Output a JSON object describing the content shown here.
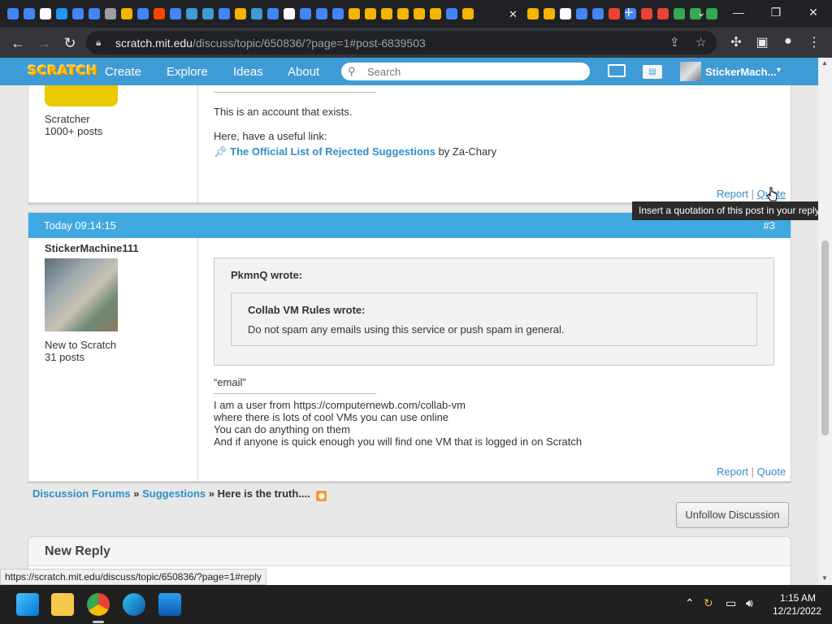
{
  "browser": {
    "tab_favicon_colors": [
      "#4285f4",
      "#4285f4",
      "#ffffff",
      "#2196f3",
      "#4285f4",
      "#4285f4",
      "#9e9e9e",
      "#f4b400",
      "#4285f4",
      "#ff4500",
      "#4285f4",
      "#3e9bd6",
      "#3e9bd6",
      "#4285f4",
      "#f4b400",
      "#3e9bd6",
      "#4285f4",
      "#ffffff",
      "#4285f4",
      "#4285f4",
      "#4285f4",
      "#f4b400",
      "#f4b400",
      "#f4b400",
      "#f4b400",
      "#f4b400",
      "#f4b400",
      "#4285f4",
      "#f4b400"
    ],
    "active_tab_close": "✕",
    "trailing_tab_colors": [
      "#f4b400",
      "#f4b400",
      "#ffffff",
      "#4285f4",
      "#4285f4",
      "#ea4335",
      "#4285f4",
      "#ea4335",
      "#ea4335",
      "#34a853",
      "#34a853",
      "#34a853"
    ],
    "new_tab": "+",
    "url_host": "scratch.mit.edu",
    "url_path": "/discuss/topic/650836/?page=1#post-6839503"
  },
  "scratch_nav": {
    "logo": "SCRATCH",
    "create": "Create",
    "explore": "Explore",
    "ideas": "Ideas",
    "about": "About",
    "search_placeholder": "Search",
    "username": "StickerMach..."
  },
  "post1": {
    "rank": "Scratcher",
    "posts": "1000+ posts",
    "sig_line1": "This is an account that exists.",
    "sig_line2": "Here, have a useful link:",
    "sig_link": "The Official List of Rejected Suggestions",
    "sig_by": " by Za-Chary",
    "report": "Report",
    "sep": "|",
    "quote": "Quote"
  },
  "tooltip": "Insert a quotation of this post in your reply.",
  "post2": {
    "time": "Today 09:14:15",
    "number": "#3",
    "author": "StickerMachine111",
    "rank": "New to Scratch",
    "posts": "31 posts",
    "outer_quote_author": "PkmnQ wrote:",
    "inner_quote_author": "Collab VM Rules wrote:",
    "inner_quote_text": "Do not spam any emails using this service or push spam in general.",
    "after_quote": "“email”",
    "sig_lines": [
      "I am a user from https://computernewb.com/collab-vm",
      "where there is lots of cool VMs you can use online",
      "You can do anything on them",
      "And if anyone is quick enough you will find one VM that is logged in on Scratch"
    ],
    "report": "Report",
    "sep": "|",
    "quote": "Quote"
  },
  "breadcrumb": {
    "forums": "Discussion Forums",
    "sep": " » ",
    "suggestions": "Suggestions",
    "topic": "Here is the truth...."
  },
  "unfollow": "Unfollow Discussion",
  "new_reply": "New Reply",
  "status_url": "https://scratch.mit.edu/discuss/topic/650836/?page=1#reply",
  "taskbar": {
    "time": "1:15 AM",
    "date": "12/21/2022"
  }
}
